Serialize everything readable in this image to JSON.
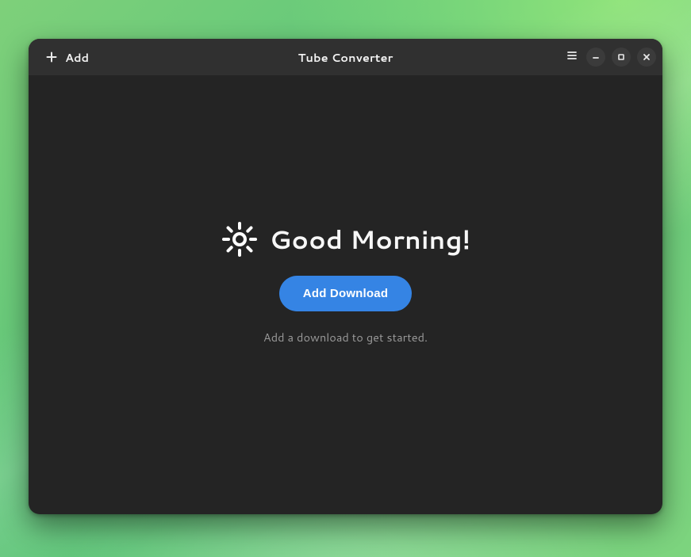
{
  "window": {
    "title": "Tube Converter"
  },
  "toolbar": {
    "add_label": "Add"
  },
  "main": {
    "greeting": "Good Morning!",
    "primary_button": "Add Download",
    "hint": "Add a download to get started."
  }
}
